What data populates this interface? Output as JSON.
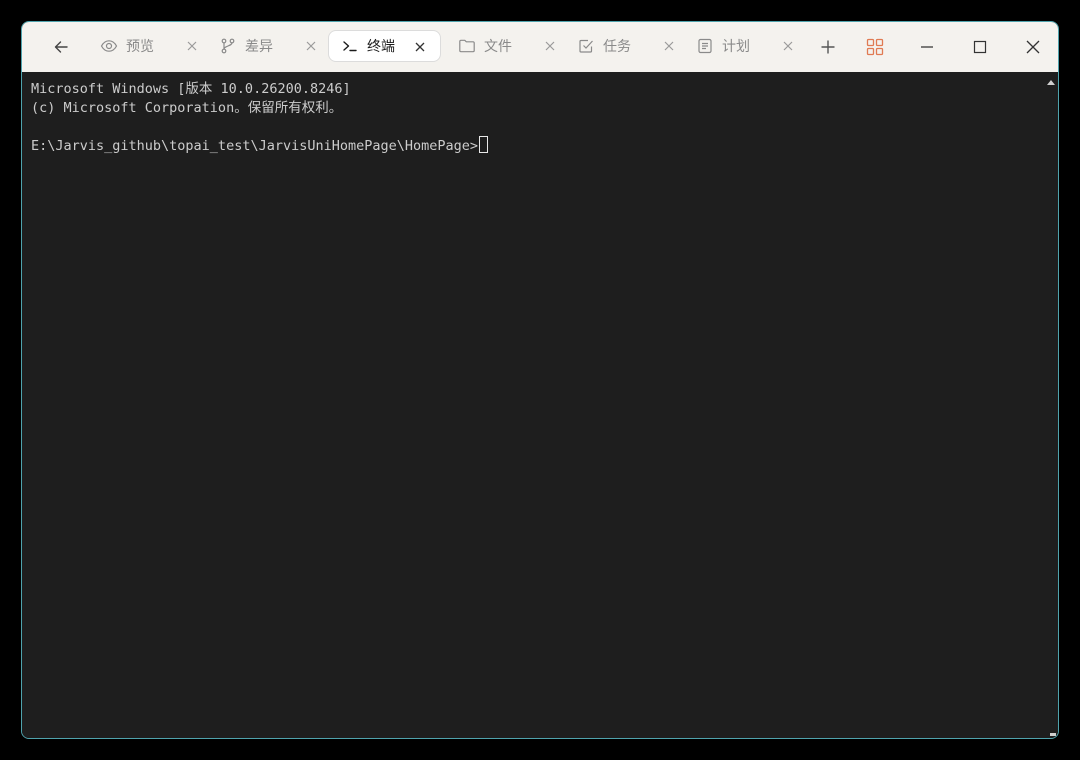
{
  "tabs": [
    {
      "label": "预览",
      "icon": "eye-icon"
    },
    {
      "label": "差异",
      "icon": "git-branch-icon"
    },
    {
      "label": "终端",
      "icon": "terminal-prompt-icon",
      "active": true
    },
    {
      "label": "文件",
      "icon": "folder-icon"
    },
    {
      "label": "任务",
      "icon": "checkbox-icon"
    },
    {
      "label": "计划",
      "icon": "document-list-icon"
    }
  ],
  "terminal": {
    "lines": [
      "Microsoft Windows [版本 10.0.26200.8246]",
      "(c) Microsoft Corporation。保留所有权利。",
      "",
      "E:\\Jarvis_github\\topai_test\\JarvisUniHomePage\\HomePage>"
    ]
  },
  "colors": {
    "tabbar_bg": "#f4f2ee",
    "terminal_bg": "#1e1e1e",
    "terminal_text": "#cccccc",
    "window_border": "#4fa3ad",
    "layout_icon_accent": "#e07a52"
  }
}
